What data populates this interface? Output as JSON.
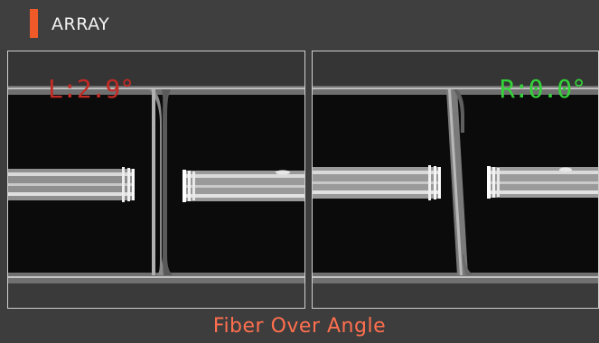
{
  "header": {
    "title": "ARRAY",
    "accent_color": "#f05a28"
  },
  "views": {
    "left": {
      "angle_label": "L:2.9°",
      "label_color": "#c42a24"
    },
    "right": {
      "angle_label": "R:0.0°",
      "label_color": "#33d238"
    }
  },
  "status": {
    "message": "Fiber Over Angle",
    "color": "#ff6f4e"
  }
}
